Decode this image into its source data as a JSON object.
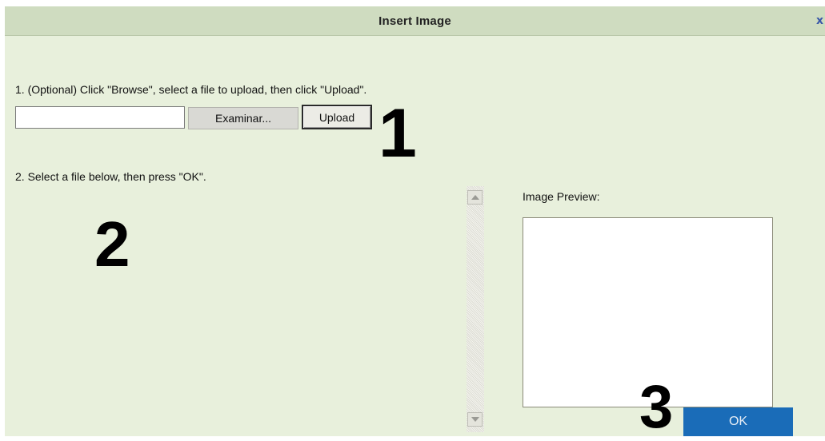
{
  "dialog": {
    "title": "Insert Image",
    "close_glyph": "x"
  },
  "step1": {
    "instruction": "1. (Optional) Click \"Browse\", select a file to upload, then click \"Upload\".",
    "file_value": "",
    "browse_label": "Examinar...",
    "upload_label": "Upload",
    "marker": "1"
  },
  "step2": {
    "instruction": "2. Select a file below, then press \"OK\".",
    "marker": "2",
    "file_list": []
  },
  "preview": {
    "label": "Image Preview:"
  },
  "step3": {
    "marker": "3",
    "ok_label": "OK"
  },
  "colors": {
    "dialog_bg": "#e8f0dc",
    "titlebar_bg": "#cfdcc0",
    "ok_button_bg": "#1a6cb8"
  },
  "icons": {
    "close": "close-icon",
    "scroll_up": "arrow-up-icon",
    "scroll_down": "arrow-down-icon"
  }
}
